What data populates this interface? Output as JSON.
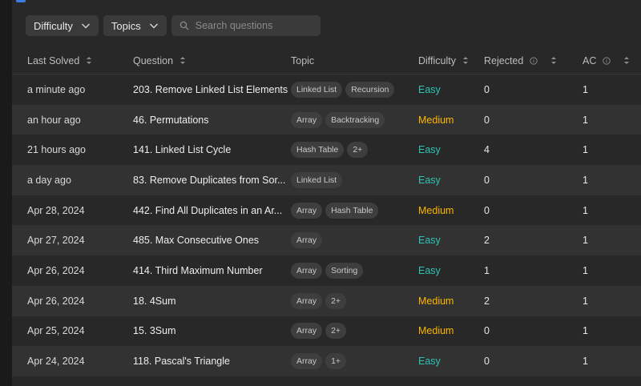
{
  "filters": {
    "difficulty_label": "Difficulty",
    "topics_label": "Topics",
    "search_placeholder": "Search questions"
  },
  "columns": {
    "last_solved": "Last Solved",
    "question": "Question",
    "topic": "Topic",
    "difficulty": "Difficulty",
    "rejected": "Rejected",
    "ac": "AC"
  },
  "colors": {
    "easy": "#2ec4b6",
    "medium": "#ffb800"
  },
  "rows": [
    {
      "last_solved": "a minute ago",
      "question": "203. Remove Linked List Elements",
      "tags": [
        "Linked List",
        "Recursion"
      ],
      "difficulty": "Easy",
      "rejected": "0",
      "ac": "1"
    },
    {
      "last_solved": "an hour ago",
      "question": "46. Permutations",
      "tags": [
        "Array",
        "Backtracking"
      ],
      "difficulty": "Medium",
      "rejected": "0",
      "ac": "1"
    },
    {
      "last_solved": "21 hours ago",
      "question": "141. Linked List Cycle",
      "tags": [
        "Hash Table",
        "2+"
      ],
      "difficulty": "Easy",
      "rejected": "4",
      "ac": "1"
    },
    {
      "last_solved": "a day ago",
      "question": "83. Remove Duplicates from Sor...",
      "tags": [
        "Linked List"
      ],
      "difficulty": "Easy",
      "rejected": "0",
      "ac": "1"
    },
    {
      "last_solved": "Apr 28, 2024",
      "question": "442. Find All Duplicates in an Ar...",
      "tags": [
        "Array",
        "Hash Table"
      ],
      "difficulty": "Medium",
      "rejected": "0",
      "ac": "1"
    },
    {
      "last_solved": "Apr 27, 2024",
      "question": "485. Max Consecutive Ones",
      "tags": [
        "Array"
      ],
      "difficulty": "Easy",
      "rejected": "2",
      "ac": "1"
    },
    {
      "last_solved": "Apr 26, 2024",
      "question": "414. Third Maximum Number",
      "tags": [
        "Array",
        "Sorting"
      ],
      "difficulty": "Easy",
      "rejected": "1",
      "ac": "1"
    },
    {
      "last_solved": "Apr 26, 2024",
      "question": "18. 4Sum",
      "tags": [
        "Array",
        "2+"
      ],
      "difficulty": "Medium",
      "rejected": "2",
      "ac": "1"
    },
    {
      "last_solved": "Apr 25, 2024",
      "question": "15. 3Sum",
      "tags": [
        "Array",
        "2+"
      ],
      "difficulty": "Medium",
      "rejected": "0",
      "ac": "1"
    },
    {
      "last_solved": "Apr 24, 2024",
      "question": "118. Pascal's Triangle",
      "tags": [
        "Array",
        "1+"
      ],
      "difficulty": "Easy",
      "rejected": "0",
      "ac": "1"
    }
  ]
}
